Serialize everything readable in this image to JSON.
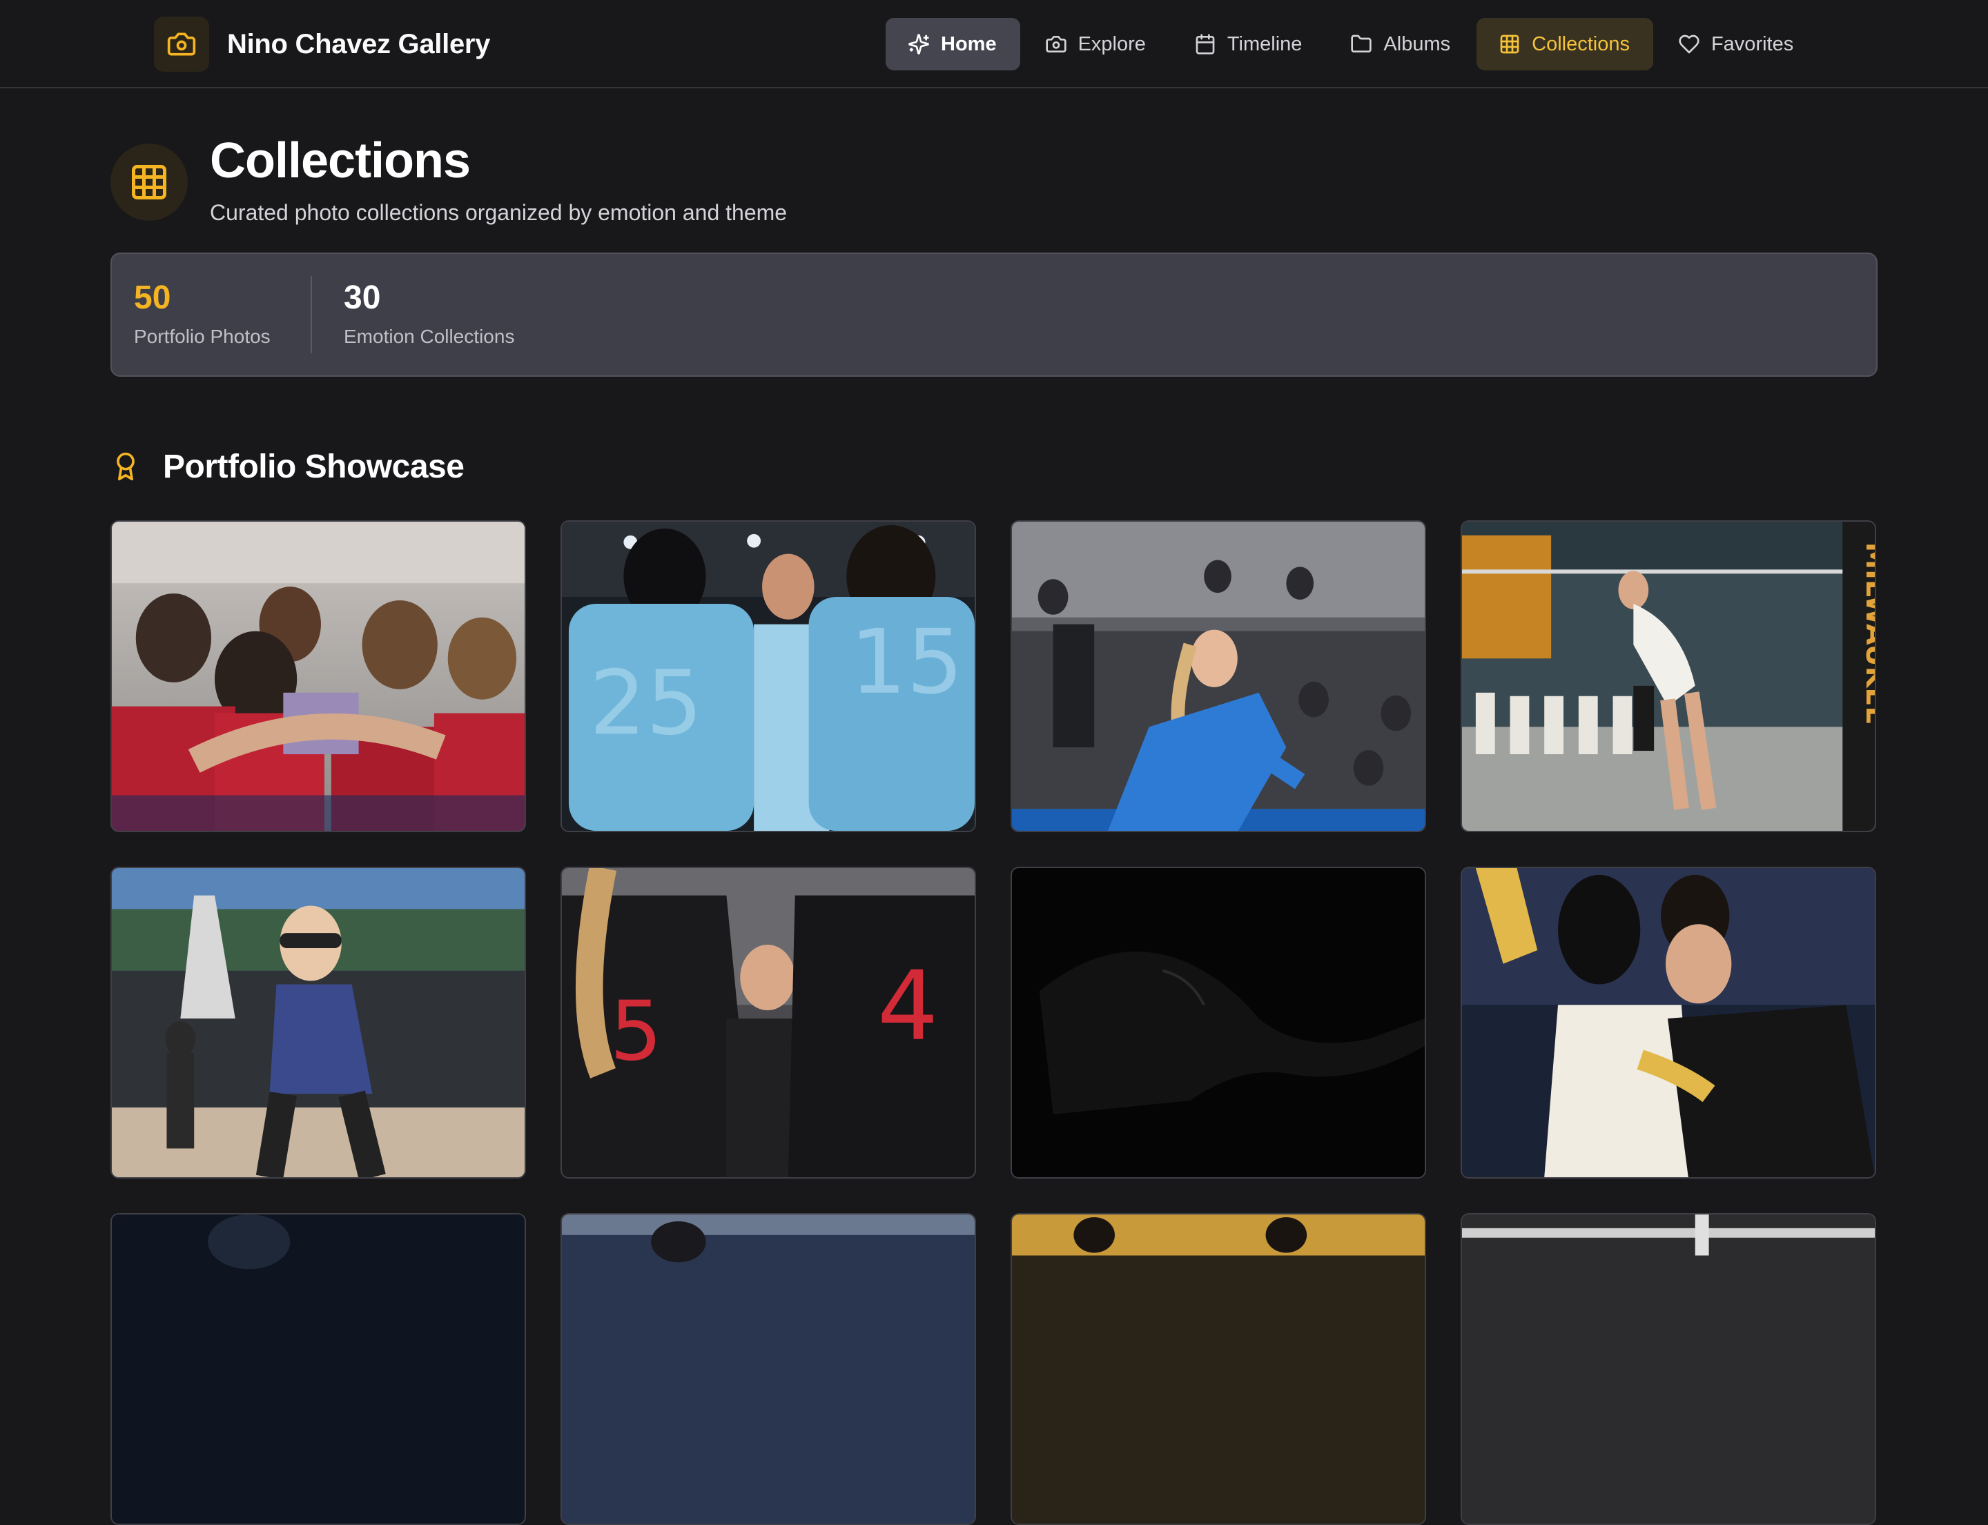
{
  "header": {
    "brand": "Nino Chavez Gallery",
    "nav": [
      {
        "label": "Home",
        "icon": "sparkles-icon"
      },
      {
        "label": "Explore",
        "icon": "camera-icon"
      },
      {
        "label": "Timeline",
        "icon": "calendar-icon"
      },
      {
        "label": "Albums",
        "icon": "folder-icon"
      },
      {
        "label": "Collections",
        "icon": "grid-icon"
      },
      {
        "label": "Favorites",
        "icon": "heart-icon"
      }
    ]
  },
  "page": {
    "title": "Collections",
    "subtitle": "Curated photo collections organized by emotion and theme",
    "icon": "grid-icon"
  },
  "stats": [
    {
      "value": "50",
      "label": "Portfolio Photos"
    },
    {
      "value": "30",
      "label": "Emotion Collections"
    }
  ],
  "section": {
    "title": "Portfolio Showcase",
    "icon": "award-icon"
  },
  "photos": [
    {
      "name": "photo-team-huddle-red"
    },
    {
      "name": "photo-icemen-players-blue"
    },
    {
      "name": "photo-player-blue-celebrating"
    },
    {
      "name": "photo-milwaukee-court-ready"
    },
    {
      "name": "photo-beach-player-gcu"
    },
    {
      "name": "photo-players-black-red-numbers"
    },
    {
      "name": "photo-silhouette-dark"
    },
    {
      "name": "photo-players-hugging"
    },
    {
      "name": "photo-row3-1"
    },
    {
      "name": "photo-row3-2"
    },
    {
      "name": "photo-row3-3"
    },
    {
      "name": "photo-row3-4"
    }
  ],
  "colors": {
    "accent": "#f5b523",
    "background": "#18181b",
    "panel": "#3f3f4a"
  }
}
